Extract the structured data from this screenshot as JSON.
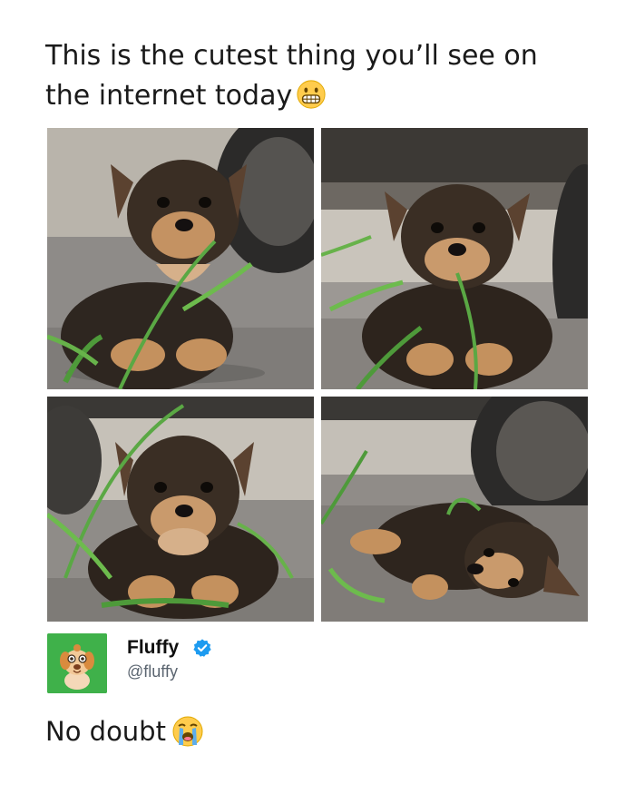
{
  "post": {
    "title_line1": "This is the cutest thing you’ll see on",
    "title_line2": "the internet today",
    "title_emoji": "grimacing-face-emoji"
  },
  "photos": [
    {
      "name": "puppy-chewing-grass-photo",
      "icon": "puppy-photo"
    },
    {
      "name": "puppy-under-car-photo",
      "icon": "puppy-photo"
    },
    {
      "name": "puppy-looking-up-photo",
      "icon": "puppy-photo"
    },
    {
      "name": "puppy-lying-sideways-photo",
      "icon": "puppy-photo"
    }
  ],
  "quoted_account": {
    "name": "Fluffy",
    "handle": "@fluffy",
    "verified": true,
    "avatar_icon": "dog-avatar",
    "avatar_color": "#3fb14a",
    "badge_color": "#1d9bf0"
  },
  "reply": {
    "text": "No doubt",
    "emoji": "loudly-crying-face-emoji"
  }
}
